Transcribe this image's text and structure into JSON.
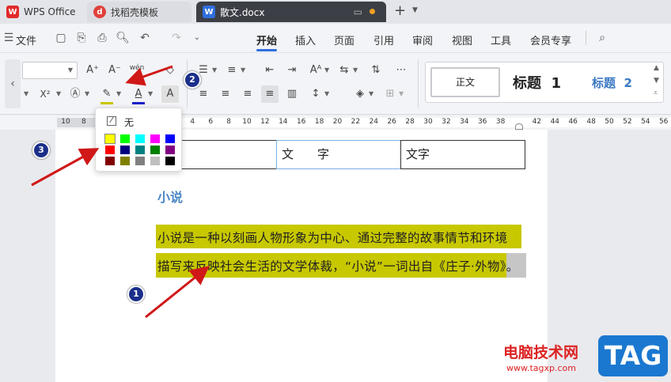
{
  "titlebar": {
    "wps_tab": "WPS Office",
    "template_tab": "找稻壳模板",
    "doc_tab": "散文.docx",
    "new_tab_icon": "plus-icon"
  },
  "menu": {
    "file": "文件",
    "tabs": [
      "开始",
      "插入",
      "页面",
      "引用",
      "审阅",
      "视图",
      "工具",
      "会员专享"
    ],
    "active_tab": "开始"
  },
  "ribbon": {
    "font_size_placeholder": "",
    "superscript": "X²",
    "styles": {
      "normal": "正文",
      "heading1": "标题  1",
      "heading2": "标题  2"
    }
  },
  "ruler": {
    "numbers": [
      "10",
      "8",
      "6",
      "4",
      "2",
      "",
      "2",
      "4",
      "6",
      "8",
      "10",
      "12",
      "14",
      "16",
      "18",
      "20",
      "22",
      "24",
      "26",
      "28",
      "30",
      "32",
      "34",
      "36",
      "38",
      "",
      "42",
      "44",
      "46",
      "48",
      "50",
      "52",
      "54",
      "56"
    ]
  },
  "picker": {
    "none_label": "无",
    "colors": [
      [
        "#ffff00",
        "#00ff00",
        "#00ffff",
        "#ff00ff",
        "#0000ff"
      ],
      [
        "#ff0000",
        "#000080",
        "#008080",
        "#008000",
        "#800080"
      ],
      [
        "#800000",
        "#808000",
        "#808080",
        "#c0c0c0",
        "#000000"
      ]
    ]
  },
  "document": {
    "table_cells": [
      "",
      "文　　字",
      "文字"
    ],
    "heading": "小说",
    "paragraph_line1": "小说是一种以刻画人物形象为中心、通过完整的故事情节和环境",
    "paragraph_line2": "描写来反映社会生活的文学体裁，“小说”一词出自《庄子·外物》。",
    "highlight_color": "#c8c800"
  },
  "annotations": {
    "step1": "1",
    "step2": "2",
    "step3": "3"
  },
  "watermark": {
    "site": "电脑技术网",
    "url": "www.tagxp.com",
    "tag": "TAG"
  }
}
